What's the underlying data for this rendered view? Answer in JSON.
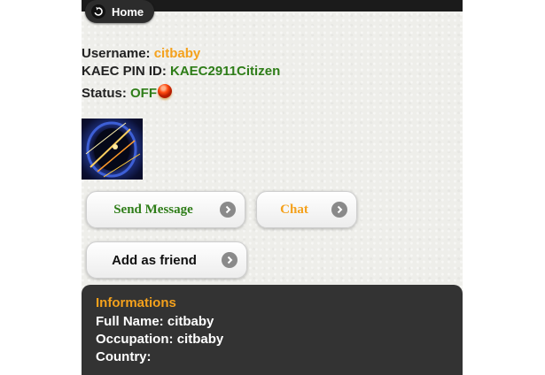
{
  "header": {
    "home_label": "Home"
  },
  "profile": {
    "username_label": "Username:",
    "username": "citbaby",
    "pin_label": "KAEC PIN ID:",
    "pin": "KAEC2911Citizen",
    "status_label": "Status:",
    "status": "OFF"
  },
  "actions": {
    "send_message": "Send Message",
    "chat": "Chat",
    "add_friend": "Add as friend"
  },
  "info": {
    "title": "Informations",
    "full_name_label": "Full Name:",
    "full_name": "citbaby",
    "occupation_label": "Occupation:",
    "occupation": "citbaby",
    "country_label": "Country:",
    "country": ""
  },
  "colors": {
    "accent_orange": "#f4a11c",
    "accent_green": "#2e7d18",
    "panel_bg": "#333333"
  },
  "icons": {
    "home": "back-arrow-icon",
    "status": "red-status-orb-icon",
    "button_arrow": "chevron-right-circle-icon"
  }
}
